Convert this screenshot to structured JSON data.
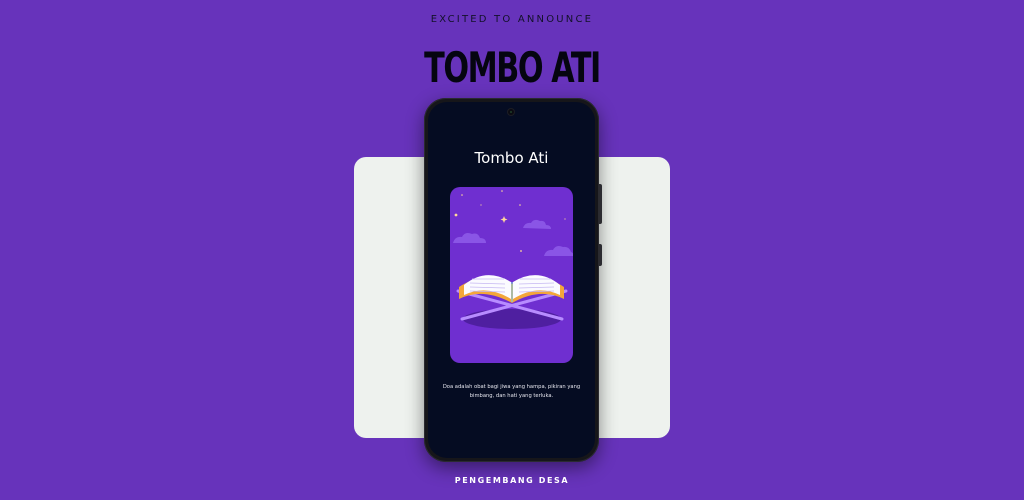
{
  "banner": {
    "eyebrow": "EXCITED TO ANNOUNCE",
    "headline": "TOMBO ATI",
    "footer": "PENGEMBANG DESA"
  },
  "phone_screen": {
    "app_title": "Tombo Ati",
    "illustration": "open-quran-on-stand-night-sky",
    "quote": "Doa adalah obat bagi jiwa yang hampa, pikiran yang bimbang, dan hati yang terluka."
  },
  "colors": {
    "background": "#6733bb",
    "card": "#eef2ee",
    "screen": "#050c22",
    "illustration_bg": "#6f2fd0"
  }
}
